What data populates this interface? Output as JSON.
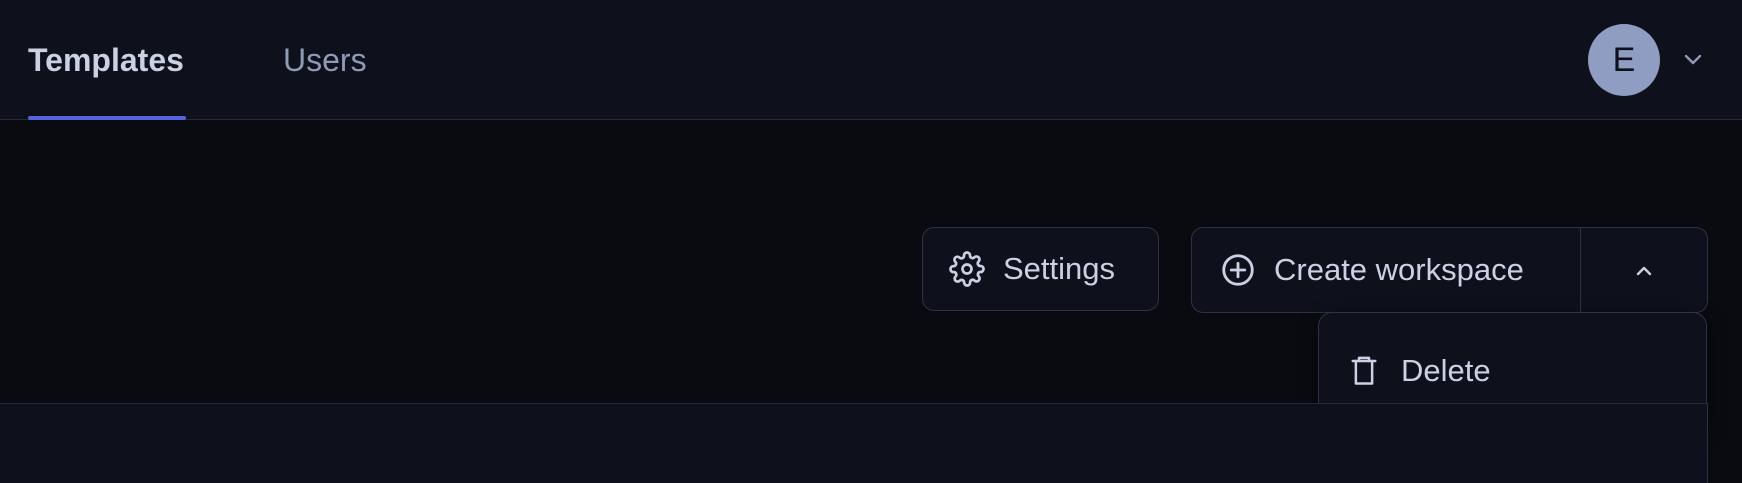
{
  "nav": {
    "tabs": [
      {
        "label": "Templates",
        "active": true
      },
      {
        "label": "Users",
        "active": false
      }
    ],
    "avatar_initial": "E",
    "accent_color": "#5563de"
  },
  "toolbar": {
    "settings_label": "Settings",
    "settings_icon": "gear-icon",
    "create_label": "Create workspace",
    "create_icon": "plus-circle-icon",
    "more_icon": "chevron-up-icon"
  },
  "menu": {
    "items": [
      {
        "label": "Delete",
        "icon": "trash-icon"
      }
    ]
  }
}
